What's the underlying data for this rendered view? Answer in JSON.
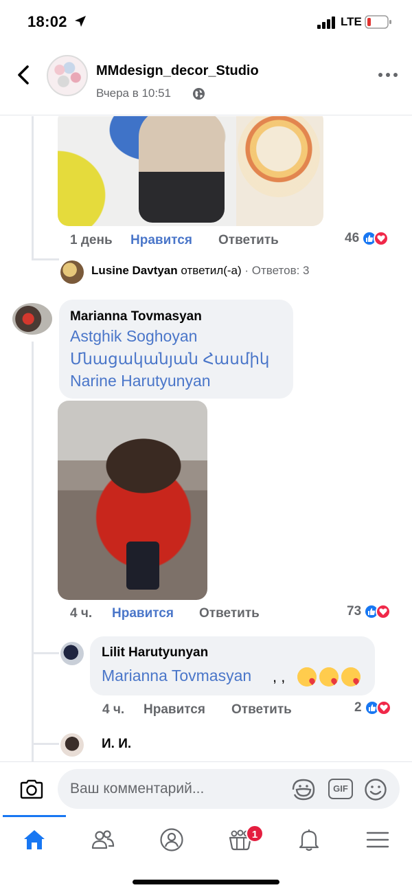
{
  "status_bar": {
    "time": "18:02",
    "network": "LTE"
  },
  "header": {
    "page_name": "MMdesign_decor_Studio",
    "post_time": "Вчера в 10:51"
  },
  "comments": {
    "first": {
      "time": "1 день",
      "like_label": "Нравится",
      "reply_label": "Ответить",
      "reaction_count": "46"
    },
    "reply_summary": {
      "name": "Lusine Davtyan",
      "verb": "ответил(-а)",
      "separator": "·",
      "count_text": "Ответов: 3"
    },
    "marianna": {
      "author": "Marianna Tovmasyan",
      "tags": [
        "Astghik Soghoyan",
        "Մնացականյան Հասմիկ",
        "Narine Harutyunyan"
      ],
      "time": "4 ч.",
      "like_label": "Нравится",
      "reply_label": "Ответить",
      "reaction_count": "73"
    },
    "lilit": {
      "author": "Lilit Harutyunyan",
      "tag": "Marianna Tovmasyan",
      "text_after": ", ,",
      "time": "4 ч.",
      "like_label": "Нравится",
      "reply_label": "Ответить",
      "reaction_count": "2"
    },
    "next": {
      "author": "И. И."
    }
  },
  "composer": {
    "placeholder": "Ваш комментарий...",
    "gif_label": "GIF"
  },
  "tabbar": {
    "items": [
      "home",
      "friends",
      "profile",
      "groups",
      "notifications",
      "menu"
    ],
    "groups_badge": "1"
  },
  "colors": {
    "accent": "#1877f2",
    "link": "#4a76c9",
    "love": "#f02849",
    "muted": "#65676b",
    "bubble": "#f0f2f5"
  }
}
